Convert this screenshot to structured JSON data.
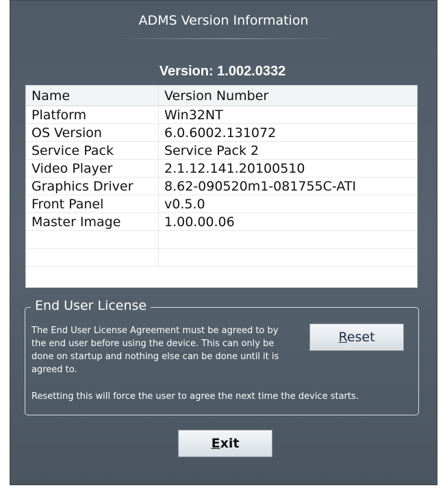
{
  "window": {
    "title": "ADMS Version Information"
  },
  "version": {
    "label": "Version: 1.002.0332"
  },
  "table": {
    "headers": [
      "Name",
      "Version Number"
    ],
    "rows": [
      {
        "name": "Platform",
        "value": "Win32NT"
      },
      {
        "name": "OS Version",
        "value": "6.0.6002.131072"
      },
      {
        "name": "Service Pack",
        "value": "Service Pack 2"
      },
      {
        "name": "Video Player",
        "value": "2.1.12.141.20100510"
      },
      {
        "name": "Graphics Driver",
        "value": "8.62-090520m1-081755C-ATI"
      },
      {
        "name": "Front Panel",
        "value": "v0.5.0"
      },
      {
        "name": "Master Image",
        "value": "1.00.00.06"
      },
      {
        "name": "",
        "value": ""
      },
      {
        "name": "",
        "value": ""
      }
    ]
  },
  "license": {
    "title": "End User License",
    "text": "The End User License Agreement must be agreed to by the end user before using the device.  This can only be done on startup and nothing else can be done until it is agreed to.",
    "note": "Resetting this will force the user to agree the next time the device starts.",
    "reset_mnemonic": "R",
    "reset_rest": "eset"
  },
  "exit": {
    "mnemonic": "E",
    "rest": "xit"
  }
}
